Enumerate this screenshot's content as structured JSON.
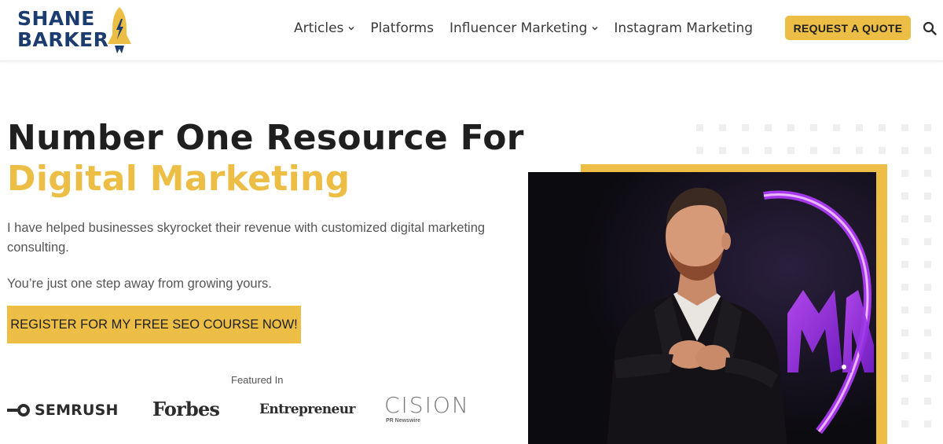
{
  "header": {
    "logo": {
      "line1": "SHANE",
      "line2": "BARKER",
      "icon": "rocket-icon"
    },
    "nav": [
      {
        "label": "Articles",
        "has_dropdown": true
      },
      {
        "label": "Platforms",
        "has_dropdown": false
      },
      {
        "label": "Influencer Marketing",
        "has_dropdown": true
      },
      {
        "label": "Instagram Marketing",
        "has_dropdown": false
      }
    ],
    "cta_label": "REQUEST A QUOTE",
    "search_icon": "search-icon"
  },
  "hero": {
    "title_line1": "Number One Resource For",
    "title_line2": "Digital Marketing",
    "paragraph1": "I have helped businesses skyrocket their revenue with customized digital marketing consulting.",
    "paragraph2": "You’re just one step away from growing yours.",
    "cta_label": "REGISTER FOR MY FREE SEO COURSE NOW!",
    "featured_label": "Featured In",
    "brands": {
      "semrush": "SEMRUSH",
      "forbes": "Forbes",
      "entrepreneur": "Entrepreneur",
      "cision": "CISION",
      "cision_sub": "PR Newswire"
    }
  },
  "colors": {
    "accent": "#ecbe45",
    "brand_navy": "#1c3b6e",
    "text": "#1f1f1f",
    "neon": "#a020f0"
  }
}
